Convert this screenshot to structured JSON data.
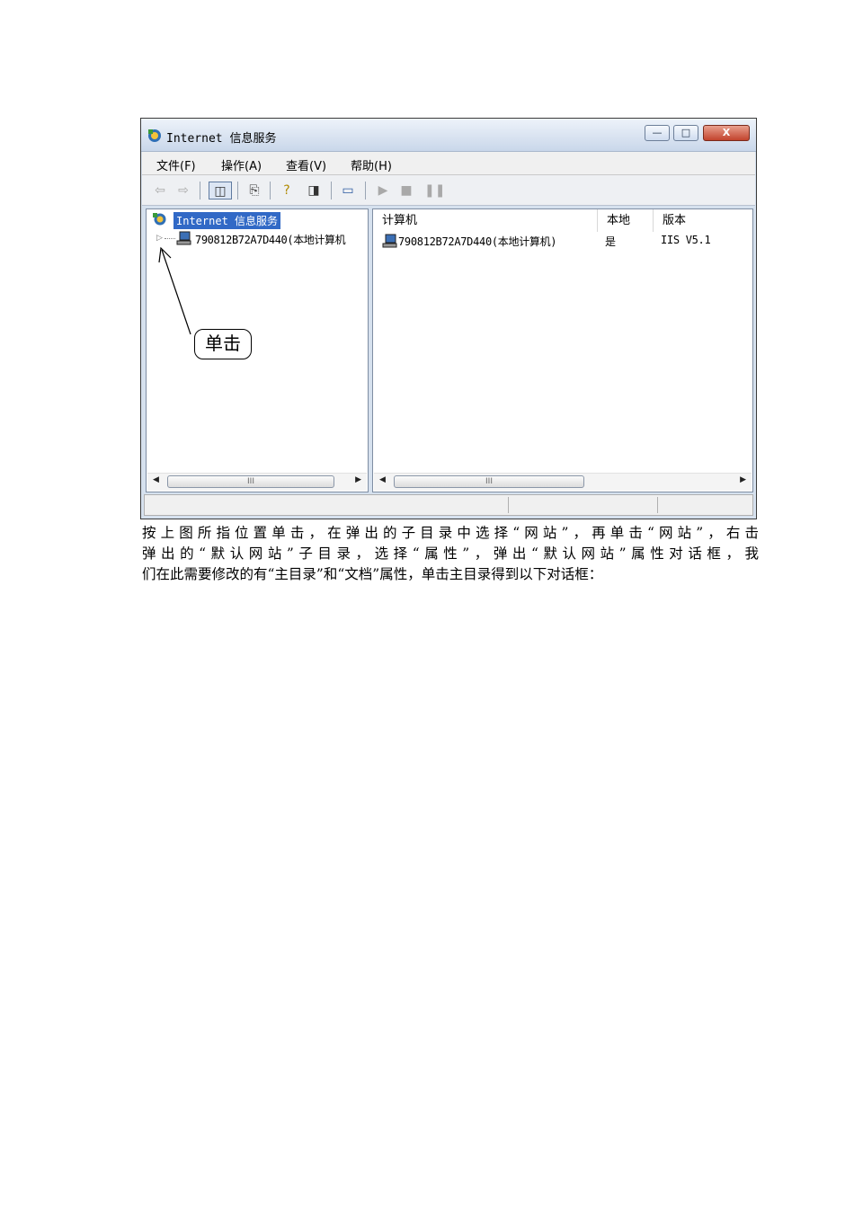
{
  "window": {
    "title": "Internet 信息服务",
    "controls": {
      "minimize": "—",
      "maximize": "□",
      "close": "X"
    }
  },
  "menubar": {
    "items": [
      "文件(F)",
      "操作(A)",
      "查看(V)",
      "帮助(H)"
    ]
  },
  "toolbar": {
    "icons": [
      "back-arrow-icon",
      "forward-arrow-icon",
      "show-hide-tree-icon",
      "export-list-icon",
      "help-icon",
      "show-hide-action-pane-icon",
      "connect-computer-icon",
      "start-icon",
      "stop-icon",
      "pause-icon"
    ]
  },
  "tree": {
    "root_label": "Internet 信息服务",
    "node_label": "790812B72A7D440(本地计算机"
  },
  "list": {
    "columns": [
      "计算机",
      "本地",
      "版本"
    ],
    "rows": [
      {
        "computer": "790812B72A7D440(本地计算机)",
        "local": "是",
        "version": "IIS V5.1"
      }
    ]
  },
  "scrollbar": {
    "thumb_grip": "III"
  },
  "annotation": {
    "callout_text": "单击"
  },
  "document": {
    "lines": [
      "按上图所指位置单击，在弹出的子目录中选择“网站”，再单击“网站”，右击",
      "弹出的“默认网站”子目录，选择“属性”，弹出“默认网站”属性对话框，我",
      "们在此需要修改的有“主目录”和“文档”属性，单击主目录得到以下对话框："
    ]
  },
  "colors": {
    "selection": "#3169c6",
    "close_button": "#c2432d",
    "frame": "#d6e1ee"
  }
}
